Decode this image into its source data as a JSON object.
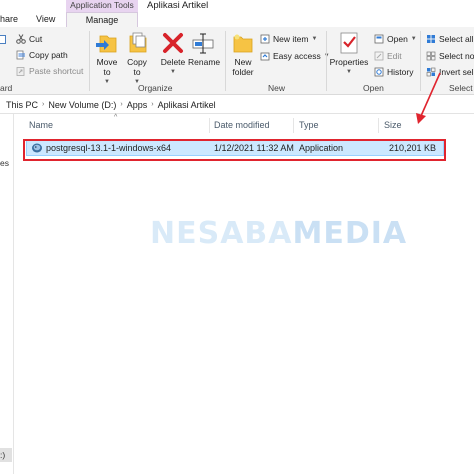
{
  "tabs": {
    "share_label": "hare",
    "view_label": "View",
    "context_header": "Application Tools",
    "manage_label": "Manage",
    "window_title": "Aplikasi Artikel"
  },
  "ribbon": {
    "clipboard": {
      "cut_label": "Cut",
      "copy_path_label": "Copy path",
      "paste_shortcut_label": "Paste shortcut",
      "group_label": "ard"
    },
    "organize": {
      "move_to_label": "Move to",
      "copy_to_label": "Copy to",
      "delete_label": "Delete",
      "rename_label": "Rename",
      "group_label": "Organize"
    },
    "new": {
      "new_folder_line1": "New",
      "new_folder_line2": "folder",
      "new_item_label": "New item",
      "easy_access_label": "Easy access",
      "group_label": "New"
    },
    "open": {
      "properties_label": "Properties",
      "open_label": "Open",
      "edit_label": "Edit",
      "history_label": "History",
      "group_label": "Open"
    },
    "select": {
      "select_all_label": "Select all",
      "select_none_label": "Select no",
      "invert_selection_label": "Invert sel",
      "group_label": "Select"
    }
  },
  "address": {
    "crumbs": [
      "This PC",
      "New Volume (D:)",
      "Apps",
      "Aplikasi Artikel"
    ]
  },
  "nav": {
    "partial_item": "es",
    "selected_partial": ":)"
  },
  "columns": {
    "name": "Name",
    "date_modified": "Date modified",
    "type": "Type",
    "size": "Size"
  },
  "files": [
    {
      "name": "postgresql-13.1-1-windows-x64",
      "date_modified": "1/12/2021 11:32 AM",
      "type": "Application",
      "size": "210,201 KB"
    }
  ],
  "watermark": {
    "part1": "NESABA",
    "part2": "MEDIA"
  },
  "colors": {
    "selection_fill": "#cce8ff",
    "selection_border": "#99d1ff",
    "annotation_red": "#e0242e",
    "context_tab": "#e8d4f0"
  }
}
